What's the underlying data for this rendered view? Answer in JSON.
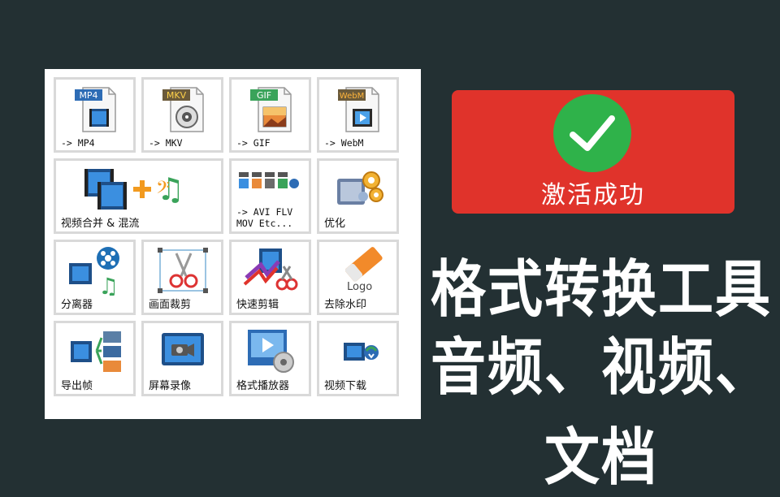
{
  "tools": [
    {
      "label": "-> MP4",
      "icon": "mp4-file-icon",
      "format": "MP4",
      "color": "#2d6cb5"
    },
    {
      "label": "-> MKV",
      "icon": "mkv-file-icon",
      "format": "MKV",
      "color": "#6b5a3a"
    },
    {
      "label": "-> GIF",
      "icon": "gif-file-icon",
      "format": "GIF",
      "color": "#3aa35a"
    },
    {
      "label": "-> WebM",
      "icon": "webm-file-icon",
      "format": "WebM",
      "color": "#6b5a3a"
    },
    {
      "label": "视频合并 & 混流",
      "icon": "video-merge-mux-icon"
    },
    {
      "label": "-> AVI FLV\nMOV Etc...",
      "icon": "multi-format-icon"
    },
    {
      "label": "优化",
      "icon": "optimize-gears-icon"
    },
    {
      "label": "分离器",
      "icon": "splitter-icon"
    },
    {
      "label": "画面裁剪",
      "icon": "crop-scissors-icon"
    },
    {
      "label": "快速剪辑",
      "icon": "quick-clip-icon"
    },
    {
      "label": "去除水印",
      "icon": "remove-watermark-icon",
      "logo_text": "Logo"
    },
    {
      "label": "导出帧",
      "icon": "export-frames-icon"
    },
    {
      "label": "屏幕录像",
      "icon": "screen-record-icon"
    },
    {
      "label": "格式播放器",
      "icon": "format-player-icon"
    },
    {
      "label": "视频下载",
      "icon": "video-download-icon"
    }
  ],
  "activation": {
    "text": "激活成功",
    "icon": "checkmark-icon",
    "color": "#e0332b",
    "check_color": "#2fb24a"
  },
  "headline": {
    "line1": "格式转换工具",
    "line2": "音频、视频、文档"
  }
}
